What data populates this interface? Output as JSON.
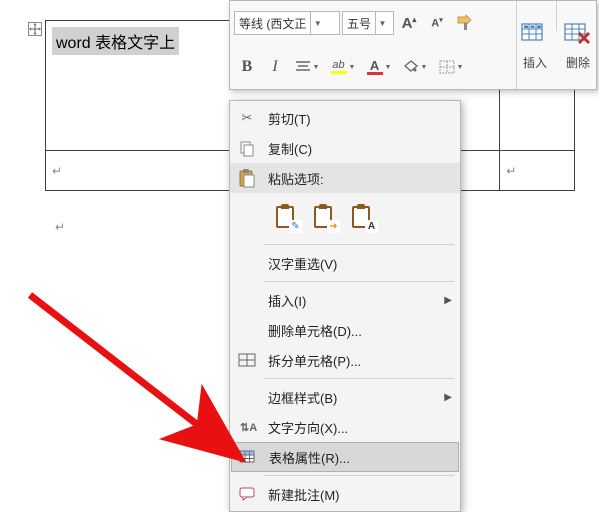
{
  "document": {
    "cell_text": "word 表格文字上"
  },
  "mini_toolbar": {
    "font_name": "等线 (西文正",
    "font_size": "五号",
    "bold": "B",
    "italic": "I",
    "insert_label": "插入",
    "delete_label": "删除"
  },
  "context_menu": {
    "cut": "剪切(T)",
    "copy": "复制(C)",
    "paste_header": "粘贴选项:",
    "hanzi_reselect": "汉字重选(V)",
    "insert": "插入(I)",
    "delete_cells": "删除单元格(D)...",
    "split_cells": "拆分单元格(P)...",
    "border_styles": "边框样式(B)",
    "text_direction": "文字方向(X)...",
    "table_properties": "表格属性(R)...",
    "new_comment": "新建批注(M)"
  }
}
